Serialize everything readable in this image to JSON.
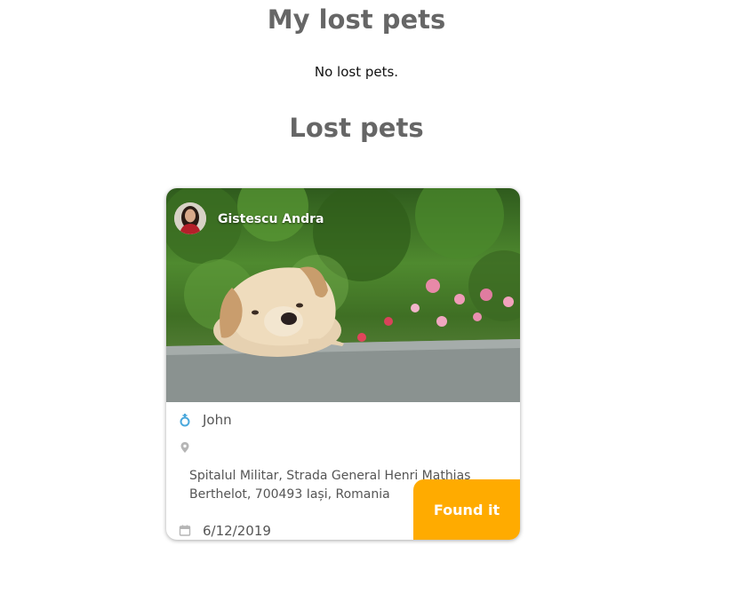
{
  "my_lost_pets": {
    "title": "My lost pets",
    "empty_message": "No lost pets."
  },
  "lost_pets": {
    "title": "Lost pets",
    "cards": [
      {
        "owner_name": "Gistescu Andra",
        "pet_name": "John",
        "location": "Spitalul Militar, Strada General Henri Mathias Berthelot, 700493 Iași, Romania",
        "date": "6/12/2019",
        "found_button_label": "Found it",
        "icons": {
          "gender": "male-gender-icon",
          "location": "map-pin-icon",
          "date": "calendar-icon"
        },
        "colors": {
          "found_button": "#ffab00",
          "gender_icon": "#4aa8dc"
        }
      }
    ]
  }
}
